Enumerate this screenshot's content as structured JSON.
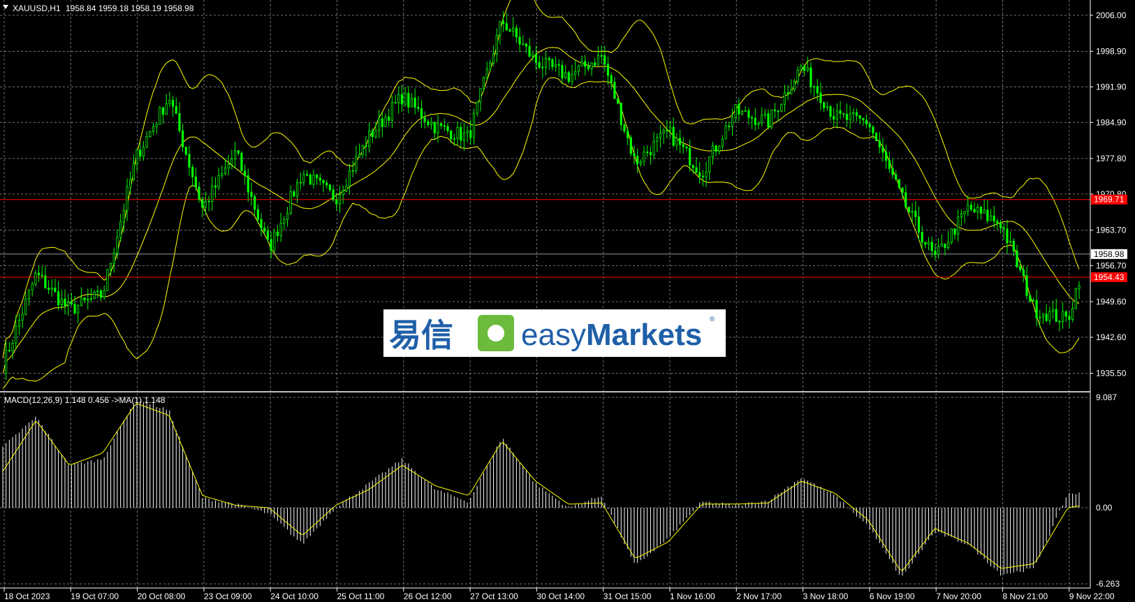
{
  "symbol_info": {
    "symbol": "XAUUSD,H1",
    "ohlc": "1958.84 1959.18 1958.19 1958.98"
  },
  "macd_info": "MACD(12,26,9) 1.148 0.456  ->MA(1) 1.148",
  "logo": {
    "chinese": "易信",
    "brand_prefix": "easy",
    "brand_suffix": "Markets",
    "registered": "®"
  },
  "colors": {
    "background": "#000000",
    "candle": "#00ff00",
    "bands": "#ffff00",
    "hline": "#ff0000",
    "grid": "#c0c0c0",
    "macd_hist": "#ffffff",
    "macd_signal": "#ffff00",
    "logo_blue": "#1f5fa8",
    "logo_green": "#6cbb3c"
  },
  "chart_data": [
    {
      "type": "candlestick",
      "title": "XAUUSD,H1",
      "ylim": [
        1932.0,
        2009.0
      ],
      "y_ticks": [
        "2006.00",
        "1998.90",
        "1991.90",
        "1984.90",
        "1977.80",
        "1970.80",
        "1963.70",
        "1956.70",
        "1949.60",
        "1942.60",
        "1935.50"
      ],
      "x_ticks": [
        "18 Oct 2023",
        "19 Oct 07:00",
        "20 Oct 08:00",
        "23 Oct 09:00",
        "24 Oct 10:00",
        "25 Oct 11:00",
        "26 Oct 12:00",
        "27 Oct 13:00",
        "30 Oct 14:00",
        "31 Oct 15:00",
        "1 Nov 16:00",
        "2 Nov 17:00",
        "3 Nov 18:00",
        "6 Nov 19:00",
        "7 Nov 20:00",
        "8 Nov 21:00",
        "9 Nov 22:00"
      ],
      "close_path_keypoints": [
        {
          "x": "18 Oct 2023",
          "y": 1937
        },
        {
          "x": "18 Oct 2023",
          "y": 1955
        },
        {
          "x": "19 Oct 07:00",
          "y": 1948
        },
        {
          "x": "19 Oct 07:00",
          "y": 1951
        },
        {
          "x": "20 Oct 08:00",
          "y": 1978
        },
        {
          "x": "20 Oct 08:00",
          "y": 1990
        },
        {
          "x": "23 Oct 09:00",
          "y": 1968
        },
        {
          "x": "23 Oct 09:00",
          "y": 1979
        },
        {
          "x": "24 Oct 10:00",
          "y": 1960
        },
        {
          "x": "24 Oct 10:00",
          "y": 1975
        },
        {
          "x": "25 Oct 11:00",
          "y": 1970
        },
        {
          "x": "25 Oct 11:00",
          "y": 1982
        },
        {
          "x": "26 Oct 12:00",
          "y": 1990
        },
        {
          "x": "26 Oct 12:00",
          "y": 1984
        },
        {
          "x": "27 Oct 13:00",
          "y": 1982
        },
        {
          "x": "27 Oct 13:00",
          "y": 2005
        },
        {
          "x": "30 Oct 14:00",
          "y": 1997
        },
        {
          "x": "30 Oct 14:00",
          "y": 1994
        },
        {
          "x": "31 Oct 15:00",
          "y": 1998
        },
        {
          "x": "31 Oct 15:00",
          "y": 1977
        },
        {
          "x": "1 Nov 16:00",
          "y": 1983
        },
        {
          "x": "1 Nov 16:00",
          "y": 1975
        },
        {
          "x": "2 Nov 17:00",
          "y": 1987
        },
        {
          "x": "2 Nov 17:00",
          "y": 1985
        },
        {
          "x": "3 Nov 18:00",
          "y": 1996
        },
        {
          "x": "3 Nov 18:00",
          "y": 1986
        },
        {
          "x": "6 Nov 19:00",
          "y": 1985
        },
        {
          "x": "6 Nov 19:00",
          "y": 1970
        },
        {
          "x": "7 Nov 20:00",
          "y": 1958
        },
        {
          "x": "7 Nov 20:00",
          "y": 1968
        },
        {
          "x": "8 Nov 21:00",
          "y": 1965
        },
        {
          "x": "8 Nov 21:00",
          "y": 1948
        },
        {
          "x": "9 Nov 22:00",
          "y": 1946
        },
        {
          "x": "9 Nov 22:00",
          "y": 1962
        },
        {
          "x": "9 Nov 22:00",
          "y": 1959
        }
      ],
      "bollinger_width": 12,
      "horizontal_lines": [
        {
          "price": 1969.71,
          "label": "1969.71",
          "color": "#ff0000"
        },
        {
          "price": 1954.43,
          "label": "1954.43",
          "color": "#ff0000"
        }
      ],
      "current_price": {
        "price": 1958.98,
        "label": "1958.98"
      }
    },
    {
      "type": "bar",
      "title": "MACD(12,26,9)",
      "ylim": [
        -6.263,
        9.087
      ],
      "y_ticks": [
        "9.087",
        "0.00",
        "-6.263"
      ],
      "histogram_keypoints": [
        {
          "x": "18 Oct 2023",
          "y": 5.0
        },
        {
          "x": "18 Oct 2023",
          "y": 7.5
        },
        {
          "x": "19 Oct 07:00",
          "y": 3.5
        },
        {
          "x": "19 Oct 07:00",
          "y": 4.0
        },
        {
          "x": "20 Oct 08:00",
          "y": 9.0
        },
        {
          "x": "20 Oct 08:00",
          "y": 8.0
        },
        {
          "x": "23 Oct 09:00",
          "y": 0.8
        },
        {
          "x": "23 Oct 09:00",
          "y": 0.3
        },
        {
          "x": "24 Oct 10:00",
          "y": -0.5
        },
        {
          "x": "24 Oct 10:00",
          "y": -3.0
        },
        {
          "x": "25 Oct 11:00",
          "y": 0.0
        },
        {
          "x": "25 Oct 11:00",
          "y": 2.0
        },
        {
          "x": "26 Oct 12:00",
          "y": 4.0
        },
        {
          "x": "26 Oct 12:00",
          "y": 1.5
        },
        {
          "x": "27 Oct 13:00",
          "y": 0.5
        },
        {
          "x": "27 Oct 13:00",
          "y": 5.8
        },
        {
          "x": "30 Oct 14:00",
          "y": 2.0
        },
        {
          "x": "30 Oct 14:00",
          "y": 0.0
        },
        {
          "x": "31 Oct 15:00",
          "y": 1.0
        },
        {
          "x": "31 Oct 15:00",
          "y": -4.8
        },
        {
          "x": "1 Nov 16:00",
          "y": -2.5
        },
        {
          "x": "1 Nov 16:00",
          "y": 0.5
        },
        {
          "x": "2 Nov 17:00",
          "y": 0.2
        },
        {
          "x": "2 Nov 17:00",
          "y": 0.6
        },
        {
          "x": "3 Nov 18:00",
          "y": 2.5
        },
        {
          "x": "3 Nov 18:00",
          "y": 1.0
        },
        {
          "x": "6 Nov 19:00",
          "y": -1.5
        },
        {
          "x": "6 Nov 19:00",
          "y": -5.8
        },
        {
          "x": "7 Nov 20:00",
          "y": -2.0
        },
        {
          "x": "7 Nov 20:00",
          "y": -3.0
        },
        {
          "x": "8 Nov 21:00",
          "y": -5.5
        },
        {
          "x": "8 Nov 21:00",
          "y": -5.0
        },
        {
          "x": "9 Nov 22:00",
          "y": 1.2
        },
        {
          "x": "9 Nov 22:00",
          "y": 1.148
        }
      ],
      "signal_keypoints": [
        {
          "x": "18 Oct 2023",
          "y": 3.0
        },
        {
          "x": "18 Oct 2023",
          "y": 7.2
        },
        {
          "x": "19 Oct 07:00",
          "y": 3.5
        },
        {
          "x": "19 Oct 07:00",
          "y": 4.5
        },
        {
          "x": "20 Oct 08:00",
          "y": 8.6
        },
        {
          "x": "20 Oct 08:00",
          "y": 7.6
        },
        {
          "x": "23 Oct 09:00",
          "y": 1.0
        },
        {
          "x": "23 Oct 09:00",
          "y": 0.2
        },
        {
          "x": "24 Oct 10:00",
          "y": 0.0
        },
        {
          "x": "24 Oct 10:00",
          "y": -2.3
        },
        {
          "x": "25 Oct 11:00",
          "y": 0.2
        },
        {
          "x": "25 Oct 11:00",
          "y": 1.5
        },
        {
          "x": "26 Oct 12:00",
          "y": 3.5
        },
        {
          "x": "26 Oct 12:00",
          "y": 1.8
        },
        {
          "x": "27 Oct 13:00",
          "y": 1.0
        },
        {
          "x": "27 Oct 13:00",
          "y": 5.5
        },
        {
          "x": "30 Oct 14:00",
          "y": 2.2
        },
        {
          "x": "30 Oct 14:00",
          "y": 0.3
        },
        {
          "x": "31 Oct 15:00",
          "y": 0.4
        },
        {
          "x": "31 Oct 15:00",
          "y": -4.2
        },
        {
          "x": "1 Nov 16:00",
          "y": -2.8
        },
        {
          "x": "1 Nov 16:00",
          "y": 0.3
        },
        {
          "x": "2 Nov 17:00",
          "y": 0.3
        },
        {
          "x": "2 Nov 17:00",
          "y": 0.4
        },
        {
          "x": "3 Nov 18:00",
          "y": 2.2
        },
        {
          "x": "3 Nov 18:00",
          "y": 1.2
        },
        {
          "x": "6 Nov 19:00",
          "y": -1.0
        },
        {
          "x": "6 Nov 19:00",
          "y": -5.3
        },
        {
          "x": "7 Nov 20:00",
          "y": -1.7
        },
        {
          "x": "7 Nov 20:00",
          "y": -2.9
        },
        {
          "x": "8 Nov 21:00",
          "y": -5.0
        },
        {
          "x": "8 Nov 21:00",
          "y": -4.6
        },
        {
          "x": "9 Nov 22:00",
          "y": 0.0
        },
        {
          "x": "9 Nov 22:00",
          "y": 0.456
        }
      ]
    }
  ]
}
